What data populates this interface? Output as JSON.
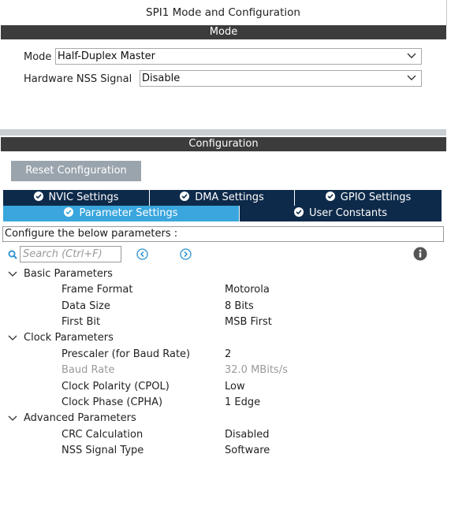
{
  "window": {
    "title": "SPI1 Mode and Configuration"
  },
  "mode_section": {
    "header": "Mode",
    "mode_label": "Mode",
    "mode_value": "Half-Duplex Master",
    "nss_label": "Hardware NSS Signal",
    "nss_value": "Disable"
  },
  "config_section": {
    "header": "Configuration",
    "reset_button": "Reset Configuration",
    "tabs_row1": [
      {
        "label": "NVIC Settings"
      },
      {
        "label": "DMA Settings"
      },
      {
        "label": "GPIO Settings"
      }
    ],
    "tabs_row2": [
      {
        "label": "Parameter Settings",
        "active": true
      },
      {
        "label": "User Constants"
      }
    ],
    "description": "Configure the below parameters :",
    "search_placeholder": "Search (Ctrl+F)"
  },
  "groups": [
    {
      "name": "Basic Parameters",
      "params": [
        {
          "name": "Frame Format",
          "value": "Motorola"
        },
        {
          "name": "Data Size",
          "value": "8 Bits"
        },
        {
          "name": "First Bit",
          "value": "MSB First"
        }
      ]
    },
    {
      "name": "Clock Parameters",
      "params": [
        {
          "name": "Prescaler (for Baud Rate)",
          "value": "2"
        },
        {
          "name": "Baud Rate",
          "value": "32.0 MBits/s",
          "disabled": true
        },
        {
          "name": "Clock Polarity (CPOL)",
          "value": "Low"
        },
        {
          "name": "Clock Phase (CPHA)",
          "value": "1 Edge"
        }
      ]
    },
    {
      "name": "Advanced Parameters",
      "params": [
        {
          "name": "CRC Calculation",
          "value": "Disabled"
        },
        {
          "name": "NSS Signal Type",
          "value": "Software"
        }
      ]
    }
  ],
  "colors": {
    "section_bar": "#3c3c3c",
    "tab_inactive": "#0e2a4a",
    "tab_active": "#3aa6dd",
    "reset_button": "#9aa4ad",
    "nav_icon": "#3aa6dd"
  },
  "icons": {
    "check": "check-circle-icon",
    "search": "search-icon",
    "prev": "arrow-left-circle-icon",
    "next": "arrow-right-circle-icon",
    "info": "info-icon",
    "dropdown": "chevron-down-icon",
    "group_toggle": "chevron-down-icon"
  }
}
